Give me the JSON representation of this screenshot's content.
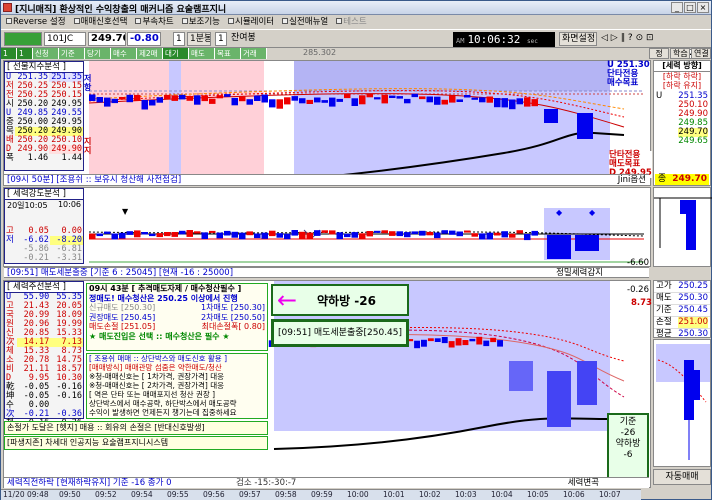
{
  "window": {
    "title": "[지니매직] 환상적인 수익창출의 매커니즘 요술램프지니",
    "min": "_",
    "max": "□",
    "close": "×"
  },
  "menu": [
    "Reverse 설정",
    "매매신호선택",
    "부속차트",
    "보조기능",
    "시뮬레이터",
    "실전매뉴얼",
    "테스트"
  ],
  "toolbar": {
    "code": "101JC",
    "price": "249.70",
    "change": "-0.80",
    "qty": "1",
    "period": "1분봉",
    "count": "1",
    "remain": "잔여봉",
    "clock_ampm": "AM",
    "clock": "10:06:32",
    "clock_suffix": "sec",
    "btn_save": "화면설정",
    "btn_icons": "◁ ▷ ∥ ? ⊙ ⊡",
    "screen_label": "화면",
    "screen_no": "20",
    "volume": "285.302"
  },
  "greenstrip": [
    "1",
    "1",
    "신청",
    "기준",
    "당기",
    "매수",
    "제2매",
    "대기",
    "매도",
    "목표",
    "거래"
  ],
  "panel1": {
    "header": "[ 선물지수분석 ]",
    "rows": [
      {
        "k": "U",
        "a": "251.35",
        "b": "251.35"
      },
      {
        "k": "저",
        "a": "250.25",
        "b": "250.15"
      },
      {
        "k": "전",
        "a": "250.25",
        "b": "250.15"
      },
      {
        "k": "시",
        "a": "250.20",
        "b": "249.95"
      },
      {
        "k": "U",
        "a": "249.85",
        "b": "249.55"
      },
      {
        "k": "중",
        "a": "250.00",
        "b": "249.95"
      },
      {
        "k": "목",
        "a": "250.20",
        "b": "249.90"
      },
      {
        "k": "배",
        "a": "250.20",
        "b": "250.10"
      },
      {
        "k": "D",
        "a": "249.90",
        "b": "249.90"
      },
      {
        "k": "폭",
        "a": "1.46",
        "b": "1.44"
      }
    ],
    "side_top": "저항",
    "side_bot": "지지",
    "status": "[09시 50분] [조용쉬 :: 보유시 청산해 사전점검]",
    "status_right": "Jini옵션",
    "tag_u": "U 251.30",
    "tag_u2": "단타전용",
    "tag_u3": "매수목표",
    "tag_d1": "단타전용",
    "tag_d2": "매도목표",
    "tag_d3": "D 249.95"
  },
  "panel2": {
    "header": "[ 세력강도분석 ]",
    "time1": "20일10:05",
    "time2": "10:06",
    "rows": [
      {
        "k": "고",
        "a": "0.05",
        "b": "0.00"
      },
      {
        "k": "저",
        "a": "-6.62",
        "b": "-8.20"
      },
      {
        "k": "",
        "a": "-5.86",
        "b": "-6.81"
      },
      {
        "k": "",
        "a": "-0.21",
        "b": "-3.31"
      }
    ],
    "status": "[09:51] 매도세분출중 [기준 6 : 25045] [현재 -16 : 25000]",
    "status_right": "정밀세력감지",
    "right_value": "-6.60"
  },
  "panel3": {
    "header": "[ 세력주선분석 ]",
    "rows": [
      {
        "k": "U",
        "a": "55.90",
        "b": "55.35"
      },
      {
        "k": "고",
        "a": "21.43",
        "b": "20.05"
      },
      {
        "k": "국",
        "a": "20.99",
        "b": "18.09"
      },
      {
        "k": "원",
        "a": "20.96",
        "b": "19.99"
      },
      {
        "k": "신",
        "a": "20.85",
        "b": "15.33"
      },
      {
        "k": "次",
        "a": "14.17",
        "b": "7.13"
      },
      {
        "k": "체",
        "a": "15.33",
        "b": "8.73"
      },
      {
        "k": "소",
        "a": "20.78",
        "b": "14.75"
      },
      {
        "k": "비",
        "a": "21.11",
        "b": "18.57"
      },
      {
        "k": "D",
        "a": "9.95",
        "b": "10.30"
      },
      {
        "k": "乾",
        "a": "-0.05",
        "b": "-0.16"
      },
      {
        "k": "坤",
        "a": "-0.05",
        "b": "-0.16"
      },
      {
        "k": "수",
        "a": "0.00",
        "b": ""
      },
      {
        "k": "次",
        "a": "-0.21",
        "b": "-0.36"
      },
      {
        "k": "체",
        "a": "-0.16",
        "b": "-0.26"
      }
    ],
    "status": "세력직전하락 [현재하락유지] 기준 -16 종가 0",
    "status_mid": "검소 -15:-30:-7",
    "status_right": "세력변곡",
    "right_top": "-0.26",
    "right_val": "8.73",
    "box_right_a": "기준",
    "box_right_b": "-26",
    "box_right_c": "약하방",
    "box_right_d": "-6"
  },
  "signal": {
    "head": "09시 43분 [ 추격매도자제 / 매수청산필수 ]",
    "l1": "정매도! 매수청산은 250.25 이상에서 진행",
    "l2a": "신규매도 [250.30]",
    "l2b": "1차매도 [250.30]",
    "l3a": "권장매도 [250.45]",
    "l3b": "2차매도 [250.50]",
    "l4a": "매도손절 [251.05]",
    "l4b": "최대손절폭[ 0.80]",
    "l5": "★ 매도진입은 선택 :: 매수청산은 필수 ★",
    "g1": "[ 조용쉬 매매 :: 상단박스와 매도신호 활용 ]",
    "g2": "[매매방식] 매매관망 섬줌은 약한매도/청산",
    "g3": "※청-매매신호는 [ 1차가격, 권장가격] 대응",
    "g4": "※청-매매신호는 [ 2차가격, 권장가격] 대응",
    "g5": "[ 역은 단타 또는 매매포지선 청산 권장 ]",
    "g6": "상단박스에서 매수공략, 하단박스에서 매도공략",
    "g7": "수익이 발생하면 언제든지 챙기는데 집중하세요",
    "b1": "손절가 도달은 [헷지] 매용 :: 회유의 손절은 [반대신호발생]",
    "b2": "[파생지존] 차세대 인공지능 요술램프지니시스템"
  },
  "popup": {
    "arrow": "←",
    "text": "약하방 -26"
  },
  "popup2": {
    "text": "[09:51] 매도세분출중[250.45]"
  },
  "right": {
    "direction_header": "[세력 방향]",
    "direction_1": "[하락 하락]",
    "direction_2": "[하락 유지]",
    "dir_rows": [
      {
        "k": "U",
        "v": "251.35"
      },
      {
        "k": "",
        "v": "250.10"
      },
      {
        "k": "",
        "v": "249.90"
      },
      {
        "k": "",
        "v": "249.85"
      },
      {
        "k": "",
        "v": "249.70"
      },
      {
        "k": "",
        "v": "249.65"
      }
    ],
    "top_btns": [
      "정",
      "학습",
      "연결"
    ],
    "last_label": "종",
    "last_value": "249.70",
    "p3_rows": [
      {
        "k": "고가",
        "v": "250.25"
      },
      {
        "k": "매도",
        "v": "250.30"
      },
      {
        "k": "기준",
        "v": "250.45"
      },
      {
        "k": "손절",
        "v": "251.00"
      },
      {
        "k": "평균",
        "v": "250.30"
      }
    ],
    "auto_btn": "자동매매"
  },
  "axis": [
    "11/20 09:48",
    "09:50",
    "09:52",
    "09:54",
    "09:55",
    "09:56",
    "09:57",
    "09:58",
    "09:59",
    "10:00",
    "10:01",
    "10:02",
    "10:03",
    "10:04",
    "10:05",
    "10:06",
    "10:07"
  ],
  "colors": {
    "up": "#e00000",
    "down": "#0000e0",
    "bg_blue": "#c8c8ff",
    "bg_pink": "#ffd0d8"
  }
}
